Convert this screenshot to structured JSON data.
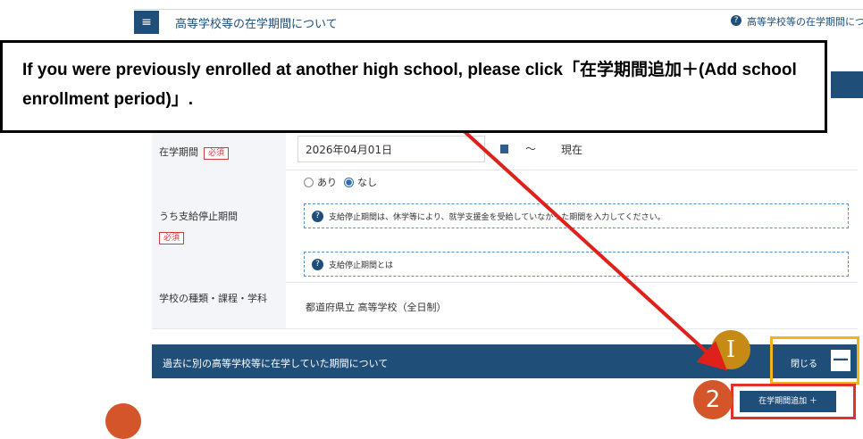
{
  "header": {
    "title": "高等学校等の在学期間について",
    "help_icon": "?",
    "help_link": "高等学校等の在学期間についての注"
  },
  "callout": {
    "text": "If you were previously enrolled at another high school, please click「在学期間追加＋(Add school enrollment period)」."
  },
  "form": {
    "enrollment_period": {
      "label": "在学期間",
      "required": "必須",
      "start_date": "2026年04月01日",
      "tilde": "～",
      "end": "現在"
    },
    "suspension": {
      "label": "うち支給停止期間",
      "required": "必須",
      "option_yes": "あり",
      "option_no": "なし",
      "selected": "なし",
      "info_text": "支給停止期間は、休学等により、就学支援金を受給していなかった期間を入力してください。",
      "info_link": "支給停止期間とは"
    },
    "school_type": {
      "label": "学校の種類・課程・学科",
      "value": "都道府県立 高等学校（全日制）"
    }
  },
  "past_section": {
    "title": "過去に別の高等学校等に在学していた期間について",
    "close_label": "閉じる",
    "close_symbol": "—",
    "add_button": "在学期間追加 ＋"
  },
  "markers": {
    "one": "I",
    "two": "2"
  },
  "colors": {
    "navy": "#1f4e79",
    "highlight_yellow": "#f2b416",
    "highlight_red": "#e0312a",
    "arrow_red": "#e0201a"
  }
}
